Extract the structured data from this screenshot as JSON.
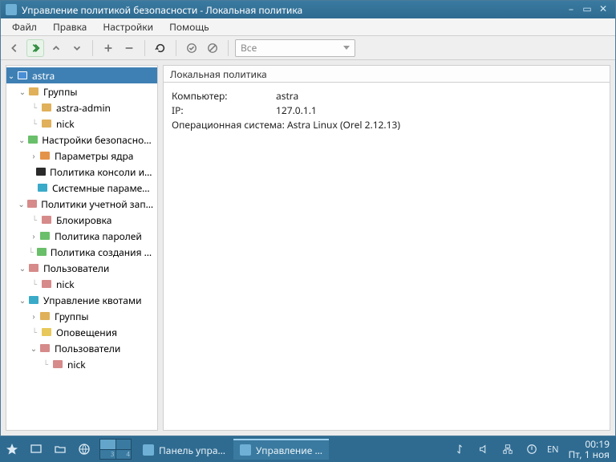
{
  "window": {
    "title": "Управление политикой безопасности - Локальная политика"
  },
  "menu": {
    "file": "Файл",
    "edit": "Правка",
    "settings": "Настройки",
    "help": "Помощь"
  },
  "toolbar": {
    "filter_placeholder": "Все"
  },
  "content": {
    "header": "Локальная политика",
    "kv": {
      "computer_k": "Компьютер:",
      "computer_v": "astra",
      "ip_k": "IP:",
      "ip_v": "127.0.1.1"
    },
    "os_line": "Операционная система: Astra Linux (Orel 2.12.13)"
  },
  "tree": [
    {
      "d": 0,
      "tw": "▾",
      "sel": true,
      "ic": "mon",
      "lbl": "astra"
    },
    {
      "d": 1,
      "tw": "▾",
      "sel": false,
      "ic": "folder",
      "lbl": "Группы"
    },
    {
      "d": 2,
      "tw": "",
      "sel": false,
      "ic": "folder",
      "lbl": "astra-admin",
      "conn": true
    },
    {
      "d": 2,
      "tw": "",
      "sel": false,
      "ic": "folder",
      "lbl": "nick",
      "conn": true
    },
    {
      "d": 1,
      "tw": "▾",
      "sel": false,
      "ic": "green",
      "lbl": "Настройки безопасности"
    },
    {
      "d": 2,
      "tw": "▸",
      "sel": false,
      "ic": "orange",
      "lbl": "Параметры ядра"
    },
    {
      "d": 2,
      "tw": "",
      "sel": false,
      "ic": "dark",
      "lbl": "Политика консоли и ин…"
    },
    {
      "d": 2,
      "tw": "",
      "sel": false,
      "ic": "cyan",
      "lbl": "Системные параметры"
    },
    {
      "d": 1,
      "tw": "▾",
      "sel": false,
      "ic": "user",
      "lbl": "Политики учетной записи"
    },
    {
      "d": 2,
      "tw": "",
      "sel": false,
      "ic": "user",
      "lbl": "Блокировка",
      "conn": true
    },
    {
      "d": 2,
      "tw": "▸",
      "sel": false,
      "ic": "green",
      "lbl": "Политика паролей"
    },
    {
      "d": 2,
      "tw": "",
      "sel": false,
      "ic": "green",
      "lbl": "Политика создания пол…",
      "conn": true
    },
    {
      "d": 1,
      "tw": "▾",
      "sel": false,
      "ic": "user",
      "lbl": "Пользователи"
    },
    {
      "d": 2,
      "tw": "",
      "sel": false,
      "ic": "user",
      "lbl": "nick",
      "conn": true
    },
    {
      "d": 1,
      "tw": "▾",
      "sel": false,
      "ic": "cyan",
      "lbl": "Управление квотами"
    },
    {
      "d": 2,
      "tw": "▸",
      "sel": false,
      "ic": "folder",
      "lbl": "Группы"
    },
    {
      "d": 2,
      "tw": "",
      "sel": false,
      "ic": "mail",
      "lbl": "Оповещения",
      "conn": true
    },
    {
      "d": 2,
      "tw": "▾",
      "sel": false,
      "ic": "user",
      "lbl": "Пользователи"
    },
    {
      "d": 3,
      "tw": "",
      "sel": false,
      "ic": "user",
      "lbl": "nick",
      "conn": true
    }
  ],
  "taskbar": {
    "task1": "Панель упра…",
    "task2": "Управление …",
    "lang": "EN",
    "time": "00:19",
    "date": "Пт, 1 ноя",
    "pager": [
      "",
      "",
      "3",
      "4"
    ]
  }
}
